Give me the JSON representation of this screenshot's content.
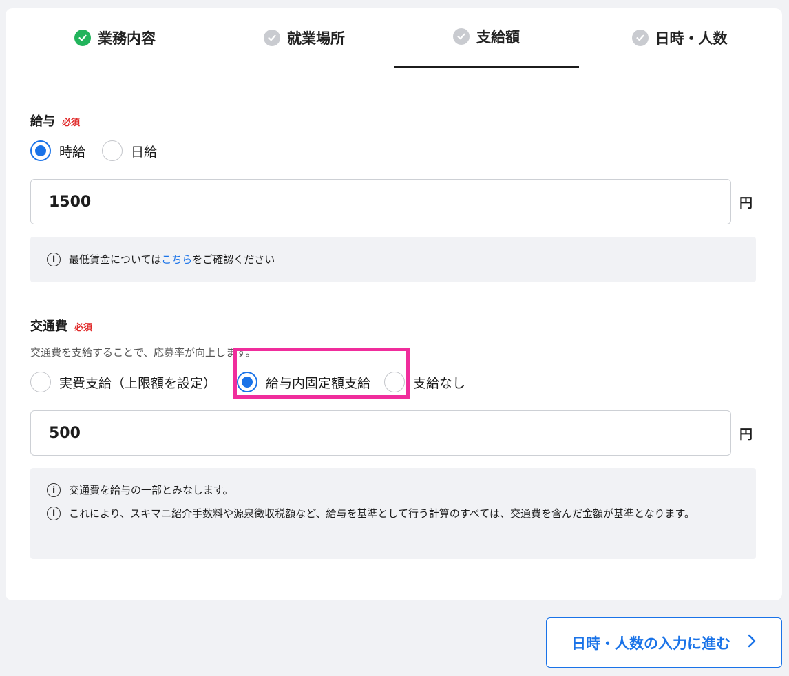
{
  "tabs": [
    {
      "label": "業務内容",
      "status": "done"
    },
    {
      "label": "就業場所",
      "status": "pending"
    },
    {
      "label": "支給額",
      "status": "active"
    },
    {
      "label": "日時・人数",
      "status": "pending"
    }
  ],
  "salary": {
    "title": "給与",
    "required": "必須",
    "options": [
      "時給",
      "日給"
    ],
    "selected": "時給",
    "value": "1500",
    "unit": "円",
    "info": {
      "before": "最低賃金については",
      "link": "こちら",
      "after": "をご確認ください"
    }
  },
  "transport": {
    "title": "交通費",
    "required": "必須",
    "description": "交通費を支給することで、応募率が向上します。",
    "options": [
      "実費支給（上限額を設定）",
      "給与内固定額支給",
      "支給なし"
    ],
    "selected": "給与内固定額支給",
    "value": "500",
    "unit": "円",
    "notes": [
      "交通費を給与の一部とみなします。",
      "これにより、スキマニ紹介手数料や源泉徴収税額など、給与を基準として行う計算のすべては、交通費を含んだ金額が基準となります。"
    ]
  },
  "next_button": {
    "label": "日時・人数の入力に進む"
  },
  "colors": {
    "accent": "#1a73e8",
    "done": "#22b45c",
    "required": "#e02828",
    "highlight": "#f02d9c"
  }
}
